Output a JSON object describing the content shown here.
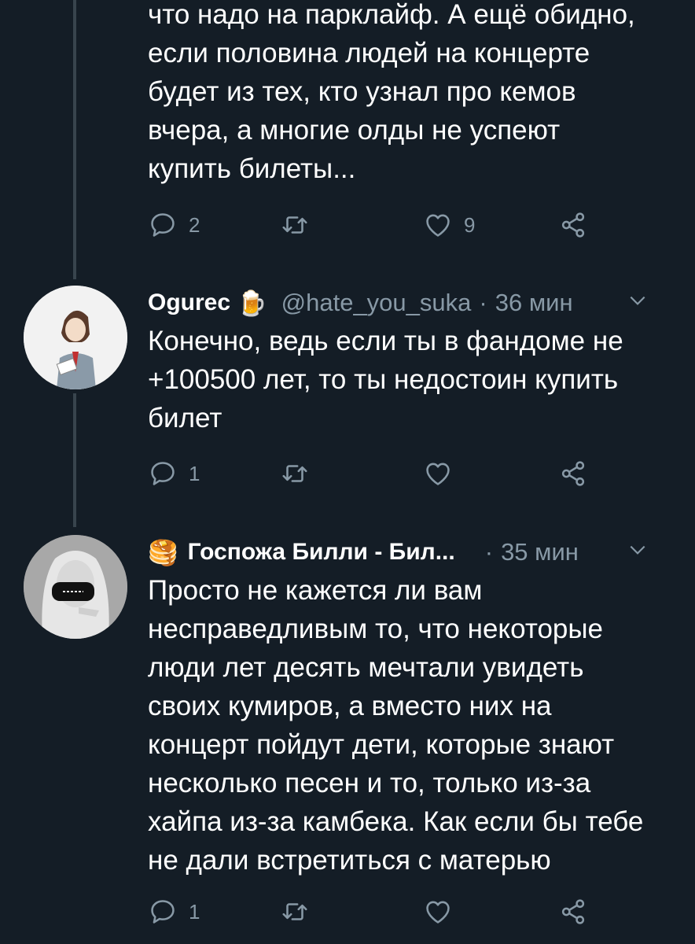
{
  "tweets": [
    {
      "text": "что надо на парклайф. А ещё обидно,\nесли половина людей на концерте\nбудет из тех, кто узнал про кемов\nвчера, а многие олды не успеют\nкупить билеты...",
      "replies": "2",
      "retweets": "",
      "likes": "9"
    },
    {
      "name": "Ogurec",
      "emoji": "🍺",
      "handle": "@hate_you_suka",
      "time": "36 мин",
      "text": "Конечно, ведь если ты в фандоме не\n+100500 лет, то ты недостоин купить\nбилет",
      "replies": "1",
      "retweets": "",
      "likes": ""
    },
    {
      "name": "Госпожа Билли - Бил...",
      "emoji": "🥞",
      "handle": "",
      "time": "35 мин",
      "text": "Просто не кажется ли вам\nнесправедливым то, что некоторые\nлюди лет десять мечтали увидеть\nсвоих кумиров, а вместо них на\nконцерт пойдут дети, которые знают\nнесколько песен и то, только из-за\nхайпа из-за камбека. Как если бы тебе\nне дали встретиться с матерью",
      "replies": "1",
      "retweets": "",
      "likes": ""
    }
  ],
  "separator": "·",
  "colors": {
    "background": "#141d26",
    "secondary": "#8899a6",
    "thread": "#38444d"
  }
}
